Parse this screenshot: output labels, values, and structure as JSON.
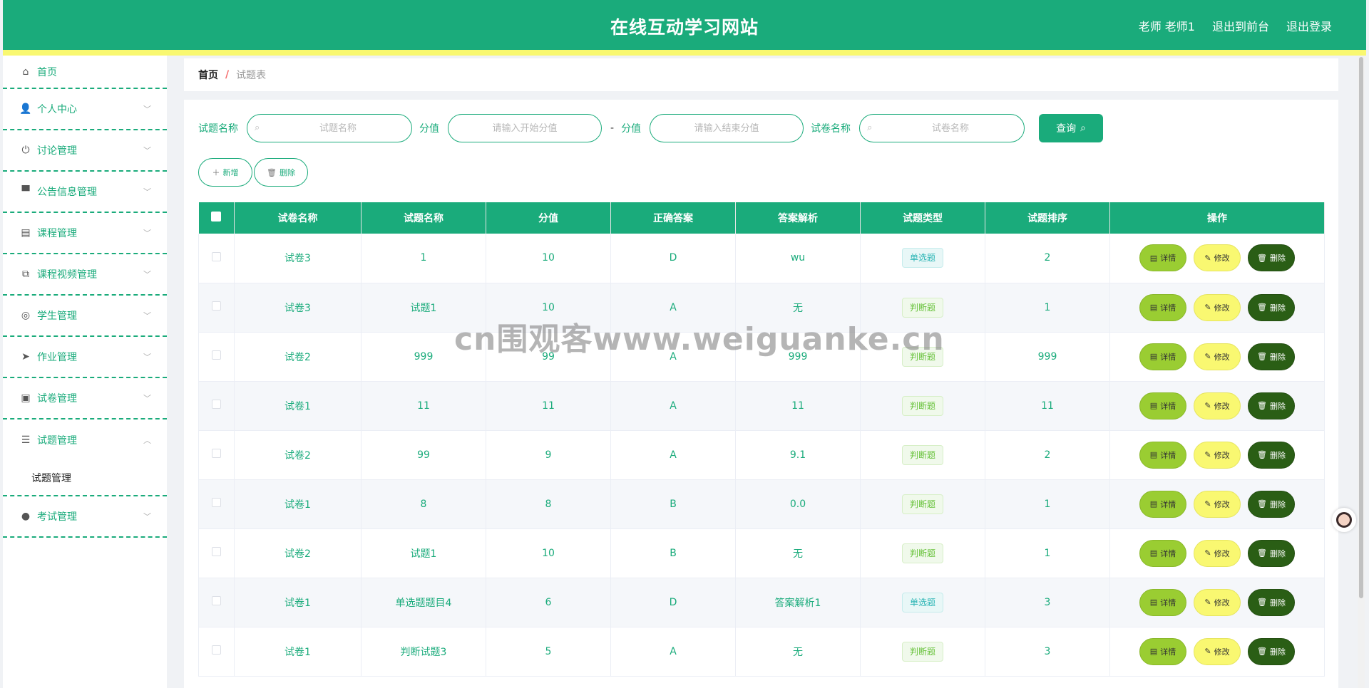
{
  "header": {
    "title": "在线互动学习网站",
    "user": "老师 老师1",
    "to_front": "退出到前台",
    "logout": "退出登录"
  },
  "sidebar": {
    "items": [
      {
        "label": "首页",
        "icon": "home-icon"
      },
      {
        "label": "个人中心",
        "icon": "user-icon"
      },
      {
        "label": "讨论管理",
        "icon": "power-icon"
      },
      {
        "label": "公告信息管理",
        "icon": "brush-icon"
      },
      {
        "label": "课程管理",
        "icon": "chart-icon"
      },
      {
        "label": "课程视频管理",
        "icon": "copy-icon"
      },
      {
        "label": "学生管理",
        "icon": "target-icon"
      },
      {
        "label": "作业管理",
        "icon": "send-icon"
      },
      {
        "label": "试卷管理",
        "icon": "clipboard-icon"
      },
      {
        "label": "试题管理",
        "icon": "list-icon"
      },
      {
        "label": "考试管理",
        "icon": "balloon-icon"
      }
    ],
    "sub_item": "试题管理"
  },
  "breadcrumb": {
    "home": "首页",
    "separator": "/",
    "current": "试题表"
  },
  "search": {
    "label_question": "试题名称",
    "placeholder_question": "试题名称",
    "label_score": "分值",
    "placeholder_score_start": "请输入开始分值",
    "dash": "-",
    "label_score2": "分值",
    "placeholder_score_end": "请输入结束分值",
    "label_paper": "试卷名称",
    "placeholder_paper": "试卷名称",
    "query_button": "查询"
  },
  "actions": {
    "add": "新增",
    "delete": "删除"
  },
  "table": {
    "headers": [
      "试卷名称",
      "试题名称",
      "分值",
      "正确答案",
      "答案解析",
      "试题类型",
      "试题排序",
      "操作"
    ],
    "ops": {
      "detail": "详情",
      "edit": "修改",
      "delete": "删除"
    },
    "rows": [
      {
        "paper": "试卷3",
        "question": "1",
        "score": "10",
        "answer": "D",
        "analysis": "wu",
        "type": "单选题",
        "type_kind": "single",
        "order": "2"
      },
      {
        "paper": "试卷3",
        "question": "试题1",
        "score": "10",
        "answer": "A",
        "analysis": "无",
        "type": "判断题",
        "type_kind": "judge",
        "order": "1"
      },
      {
        "paper": "试卷2",
        "question": "999",
        "score": "99",
        "answer": "A",
        "analysis": "999",
        "type": "判断题",
        "type_kind": "judge",
        "order": "999"
      },
      {
        "paper": "试卷1",
        "question": "11",
        "score": "11",
        "answer": "A",
        "analysis": "11",
        "type": "判断题",
        "type_kind": "judge",
        "order": "11"
      },
      {
        "paper": "试卷2",
        "question": "99",
        "score": "9",
        "answer": "A",
        "analysis": "9.1",
        "type": "判断题",
        "type_kind": "judge",
        "order": "2"
      },
      {
        "paper": "试卷1",
        "question": "8",
        "score": "8",
        "answer": "B",
        "analysis": "0.0",
        "type": "判断题",
        "type_kind": "judge",
        "order": "1"
      },
      {
        "paper": "试卷2",
        "question": "试题1",
        "score": "10",
        "answer": "B",
        "analysis": "无",
        "type": "判断题",
        "type_kind": "judge",
        "order": "1"
      },
      {
        "paper": "试卷1",
        "question": "单选题题目4",
        "score": "6",
        "answer": "D",
        "analysis": "答案解析1",
        "type": "单选题",
        "type_kind": "single",
        "order": "3"
      },
      {
        "paper": "试卷1",
        "question": "判断试题3",
        "score": "5",
        "answer": "A",
        "analysis": "无",
        "type": "判断题",
        "type_kind": "judge",
        "order": "3"
      }
    ]
  },
  "watermark": "cn围观客www.weiguanke.cn",
  "colors": {
    "primary": "#1aab7b",
    "accent_yellow": "#f9f871",
    "detail_btn": "#9acd32",
    "delete_btn": "#2a5e15"
  }
}
